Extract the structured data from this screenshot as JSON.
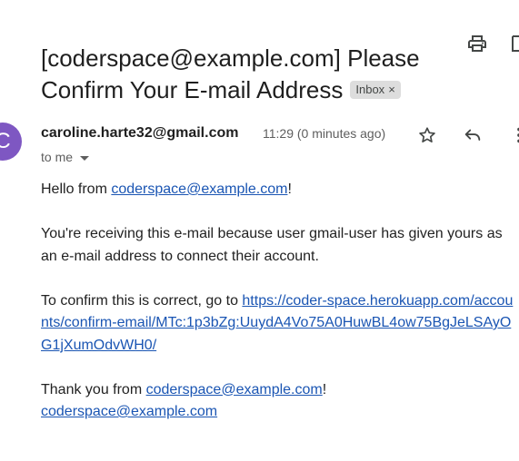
{
  "email": {
    "subject": "[coderspace@example.com] Please Confirm Your E-mail Address",
    "label_chip": "Inbox",
    "label_chip_close": "×",
    "avatar_letter": "C",
    "sender": "caroline.harte32@gmail.com",
    "time": "11:29 (0 minutes ago)",
    "recipient": "to me",
    "body": {
      "greeting_prefix": "Hello from ",
      "greeting_link": "coderspace@example.com",
      "greeting_suffix": "!",
      "reason": "You're receiving this e-mail because user gmail-user has given yours as an e-mail address to connect their account.",
      "confirm_prefix": "To confirm this is correct, go to ",
      "confirm_url": "https://coder-space.herokuapp.com/accounts/confirm-email/MTc:1p3bZg:UuydA4Vo75A0HuwBL4ow75BgJeLSAyOG1jXumOdvWH0/",
      "thanks_prefix": "Thank you from ",
      "thanks_link": "coderspace@example.com",
      "thanks_suffix": "!",
      "signature_link": "coderspace@example.com"
    }
  },
  "icons": {
    "print": "print-icon",
    "open_new_window": "open-in-new-window-icon",
    "star": "star-icon",
    "reply": "reply-icon",
    "more": "more-vert-icon",
    "recipient_details": "chevron-down-icon"
  },
  "colors": {
    "link": "#1a55b3",
    "avatar": "#7e57c2",
    "chip_bg": "#dddddd"
  }
}
